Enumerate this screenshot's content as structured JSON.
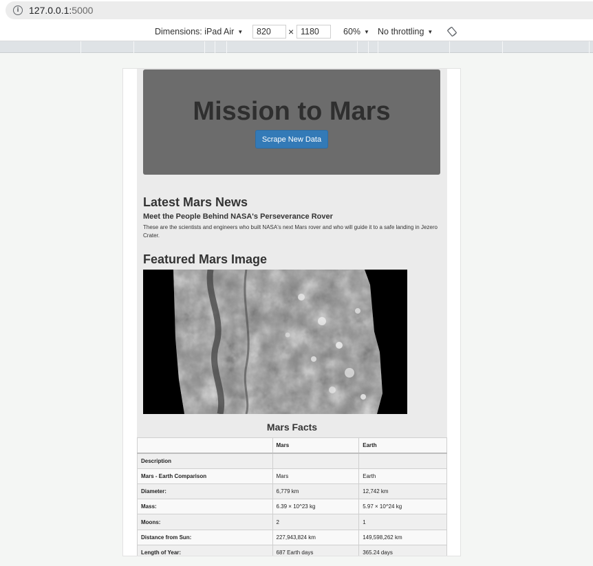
{
  "browser": {
    "url_host": "127.0.0.1:",
    "url_port": "5000"
  },
  "device_toolbar": {
    "dimensions_label": "Dimensions: iPad Air",
    "width_value": "820",
    "times": "×",
    "height_value": "1180",
    "zoom": "60%",
    "throttling": "No throttling"
  },
  "page": {
    "title": "Mission to Mars",
    "scrape_button": "Scrape New Data",
    "news_heading": "Latest Mars News",
    "news_title": "Meet the People Behind NASA's Perseverance Rover",
    "news_body": "These are the scientists and engineers who built NASA's next Mars rover and who will guide it to a safe landing in Jezero Crater.",
    "featured_heading": "Featured Mars Image",
    "facts_heading": "Mars Facts"
  },
  "facts_table": {
    "headers": [
      "",
      "Mars",
      "Earth"
    ],
    "rows": [
      [
        "Description",
        "",
        ""
      ],
      [
        "Mars - Earth Comparison",
        "Mars",
        "Earth"
      ],
      [
        "Diameter:",
        "6,779 km",
        "12,742 km"
      ],
      [
        "Mass:",
        "6.39 × 10^23 kg",
        "5.97 × 10^24 kg"
      ],
      [
        "Moons:",
        "2",
        "1"
      ],
      [
        "Distance from Sun:",
        "227,943,824 km",
        "149,598,262 km"
      ],
      [
        "Length of Year:",
        "687 Earth days",
        "365.24 days"
      ]
    ]
  }
}
